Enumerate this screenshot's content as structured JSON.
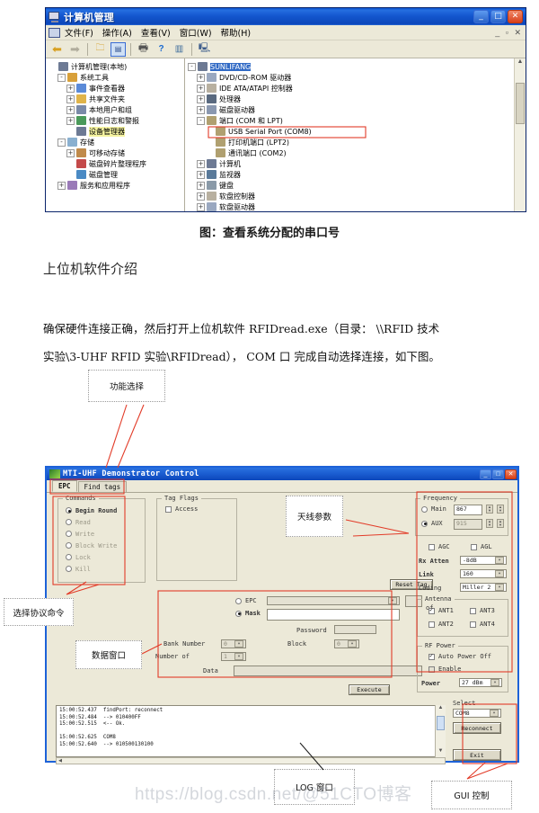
{
  "computer_management": {
    "title": "计算机管理",
    "window_buttons": [
      "_",
      "□",
      "✕"
    ],
    "mdi_buttons": [
      "_",
      "▫",
      "✕"
    ],
    "menus": [
      "文件(F)",
      "操作(A)",
      "查看(V)",
      "窗口(W)",
      "帮助(H)"
    ],
    "toolbar_icons": [
      "back-arrow",
      "forward-arrow",
      "up-folder",
      "properties",
      "print",
      "help",
      "view",
      "console"
    ],
    "left_tree": [
      {
        "label": "计算机管理(本地)",
        "indent": 0,
        "expander": "",
        "icon": "#6d7a94"
      },
      {
        "label": "系统工具",
        "indent": 1,
        "expander": "-",
        "icon": "#d8a03a"
      },
      {
        "label": "事件查看器",
        "indent": 2,
        "expander": "+",
        "icon": "#5a8ad8"
      },
      {
        "label": "共享文件夹",
        "indent": 2,
        "expander": "+",
        "icon": "#e0b44a"
      },
      {
        "label": "本地用户和组",
        "indent": 2,
        "expander": "+",
        "icon": "#7a8aa8"
      },
      {
        "label": "性能日志和警报",
        "indent": 2,
        "expander": "+",
        "icon": "#4a9a5a"
      },
      {
        "label": "设备管理器",
        "indent": 2,
        "expander": "",
        "icon": "#6d7a94",
        "selected": true
      },
      {
        "label": "存储",
        "indent": 1,
        "expander": "-",
        "icon": "#8ab0d0"
      },
      {
        "label": "可移动存储",
        "indent": 2,
        "expander": "+",
        "icon": "#c08a4a"
      },
      {
        "label": "磁盘碎片整理程序",
        "indent": 2,
        "expander": "",
        "icon": "#c44a4a"
      },
      {
        "label": "磁盘管理",
        "indent": 2,
        "expander": "",
        "icon": "#4a8ac4"
      },
      {
        "label": "服务和应用程序",
        "indent": 1,
        "expander": "+",
        "icon": "#9a7ab8"
      }
    ],
    "right_tree": [
      {
        "label": "SUNLIFANG",
        "indent": 0,
        "expander": "-",
        "icon": "#6d7a94",
        "highlight": true
      },
      {
        "label": "DVD/CD-ROM 驱动器",
        "indent": 1,
        "expander": "+",
        "icon": "#9aa8c0"
      },
      {
        "label": "IDE ATA/ATAPI 控制器",
        "indent": 1,
        "expander": "+",
        "icon": "#b8b0a0"
      },
      {
        "label": "处理器",
        "indent": 1,
        "expander": "+",
        "icon": "#5a6a80"
      },
      {
        "label": "磁盘驱动器",
        "indent": 1,
        "expander": "+",
        "icon": "#8a98b0"
      },
      {
        "label": "端口 (COM 和 LPT)",
        "indent": 1,
        "expander": "-",
        "icon": "#b0a070"
      },
      {
        "label": "USB Serial Port (COM8)",
        "indent": 2,
        "expander": "",
        "icon": "#b0a070",
        "boxed": true
      },
      {
        "label": "打印机端口 (LPT2)",
        "indent": 2,
        "expander": "",
        "icon": "#b0a070"
      },
      {
        "label": "通讯端口 (COM2)",
        "indent": 2,
        "expander": "",
        "icon": "#b0a070"
      },
      {
        "label": "计算机",
        "indent": 1,
        "expander": "+",
        "icon": "#6d7a94"
      },
      {
        "label": "监视器",
        "indent": 1,
        "expander": "+",
        "icon": "#5a7a9a"
      },
      {
        "label": "键盘",
        "indent": 1,
        "expander": "+",
        "icon": "#8a9aa8"
      },
      {
        "label": "软盘控制器",
        "indent": 1,
        "expander": "+",
        "icon": "#b8b0a0"
      },
      {
        "label": "软盘驱动器",
        "indent": 1,
        "expander": "+",
        "icon": "#9aa8c0"
      }
    ]
  },
  "doc": {
    "figure_caption_1": "图：查看系统分配的串口号",
    "section_heading": "上位机软件介绍",
    "paragraph_line_1": "确保硬件连接正确，然后打开上位机软件    RFIDread.exe（目录： \\\\RFID 技术",
    "paragraph_line_2": "实验\\3-UHF RFID 实验\\RFIDread）， COM 口 完成自动选择连接，如下图。",
    "callout_function_select": "功能选择",
    "callout_antenna_params": "天线参数",
    "callout_protocol_command": "选择协议命令",
    "callout_data_window": "数据窗口",
    "callout_log_window": "LOG 窗口",
    "callout_gui_control": "GUI 控制",
    "watermark": "https://blog.csdn.net/@51CTO博客"
  },
  "rfid_app": {
    "title": "MTI-UHF Demonstrator Control",
    "window_buttons": [
      "_",
      "□",
      "✕"
    ],
    "tabs": [
      {
        "label": "EPC",
        "active": true
      },
      {
        "label": "Find tags",
        "active": false
      }
    ],
    "commands": {
      "legend": "Commands",
      "options": [
        {
          "label": "Begin Round",
          "selected": true,
          "enabled": true
        },
        {
          "label": "Read",
          "selected": false,
          "enabled": false
        },
        {
          "label": "Write",
          "selected": false,
          "enabled": false
        },
        {
          "label": "Block Write",
          "selected": false,
          "enabled": false
        },
        {
          "label": "Lock",
          "selected": false,
          "enabled": false
        },
        {
          "label": "Kill",
          "selected": false,
          "enabled": false
        }
      ]
    },
    "tag_flags": {
      "legend": "Tag Flags",
      "options": [
        {
          "label": "Access",
          "checked": false
        }
      ]
    },
    "reset_tag_button": "Reset Tag",
    "execute_button": "Execute",
    "data_panel": {
      "epc_label": "EPC",
      "epc_selected": false,
      "epc_value": "",
      "no_of_label": "No of",
      "no_of_value": "",
      "mask_label": "Mask",
      "mask_selected": true,
      "mask_value": "",
      "password_label": "Password",
      "password_value": "",
      "bank_number_label": "Bank Number",
      "bank_number_value": "0",
      "block_label": "Block",
      "block_value": "0",
      "number_of_label": "Number of",
      "number_of_value": "1",
      "data_label": "Data",
      "data_value": ""
    },
    "frequency": {
      "legend": "Frequency",
      "main_label": "Main",
      "main_selected": false,
      "main_value": "867",
      "aux_label": "AUX",
      "aux_selected": true,
      "aux_value": "915"
    },
    "radio_settings": {
      "agc_label": "AGC",
      "agc_checked": false,
      "agl_label": "AGL",
      "agl_checked": false,
      "rx_atten_label": "Rx Atten",
      "rx_atten_value": "-8dB",
      "link_label": "Link",
      "link_value": "160",
      "coding_label": "Coding",
      "coding_value": "Miller 2"
    },
    "antenna": {
      "legend": "Antenna",
      "options": [
        {
          "label": "ANT1",
          "checked": true
        },
        {
          "label": "ANT3",
          "checked": false
        },
        {
          "label": "ANT2",
          "checked": false
        },
        {
          "label": "ANT4",
          "checked": false
        }
      ]
    },
    "rf_power": {
      "legend": "RF Power",
      "auto_power_off_label": "Auto Power Off",
      "auto_power_off_checked": true,
      "enable_label": "Enable",
      "enable_checked": false,
      "power_label": "Power",
      "power_value": "27 dBm"
    },
    "log": [
      {
        "time": "15:00:52.437",
        "text": "findPort: reconnect"
      },
      {
        "time": "15:00:52.484",
        "text": "--> 010400FF"
      },
      {
        "time": "15:00:52.515",
        "text": "<-- Ok."
      },
      {
        "time": "",
        "text": ""
      },
      {
        "time": "15:00:52.625",
        "text": "COM8"
      },
      {
        "time": "15:00:52.640",
        "text": "--> 010500130100"
      }
    ],
    "gui_control": {
      "select_label": "Select",
      "port_value": "COM8",
      "reconnect_button": "Reconnect",
      "exit_button": "Exit"
    }
  }
}
